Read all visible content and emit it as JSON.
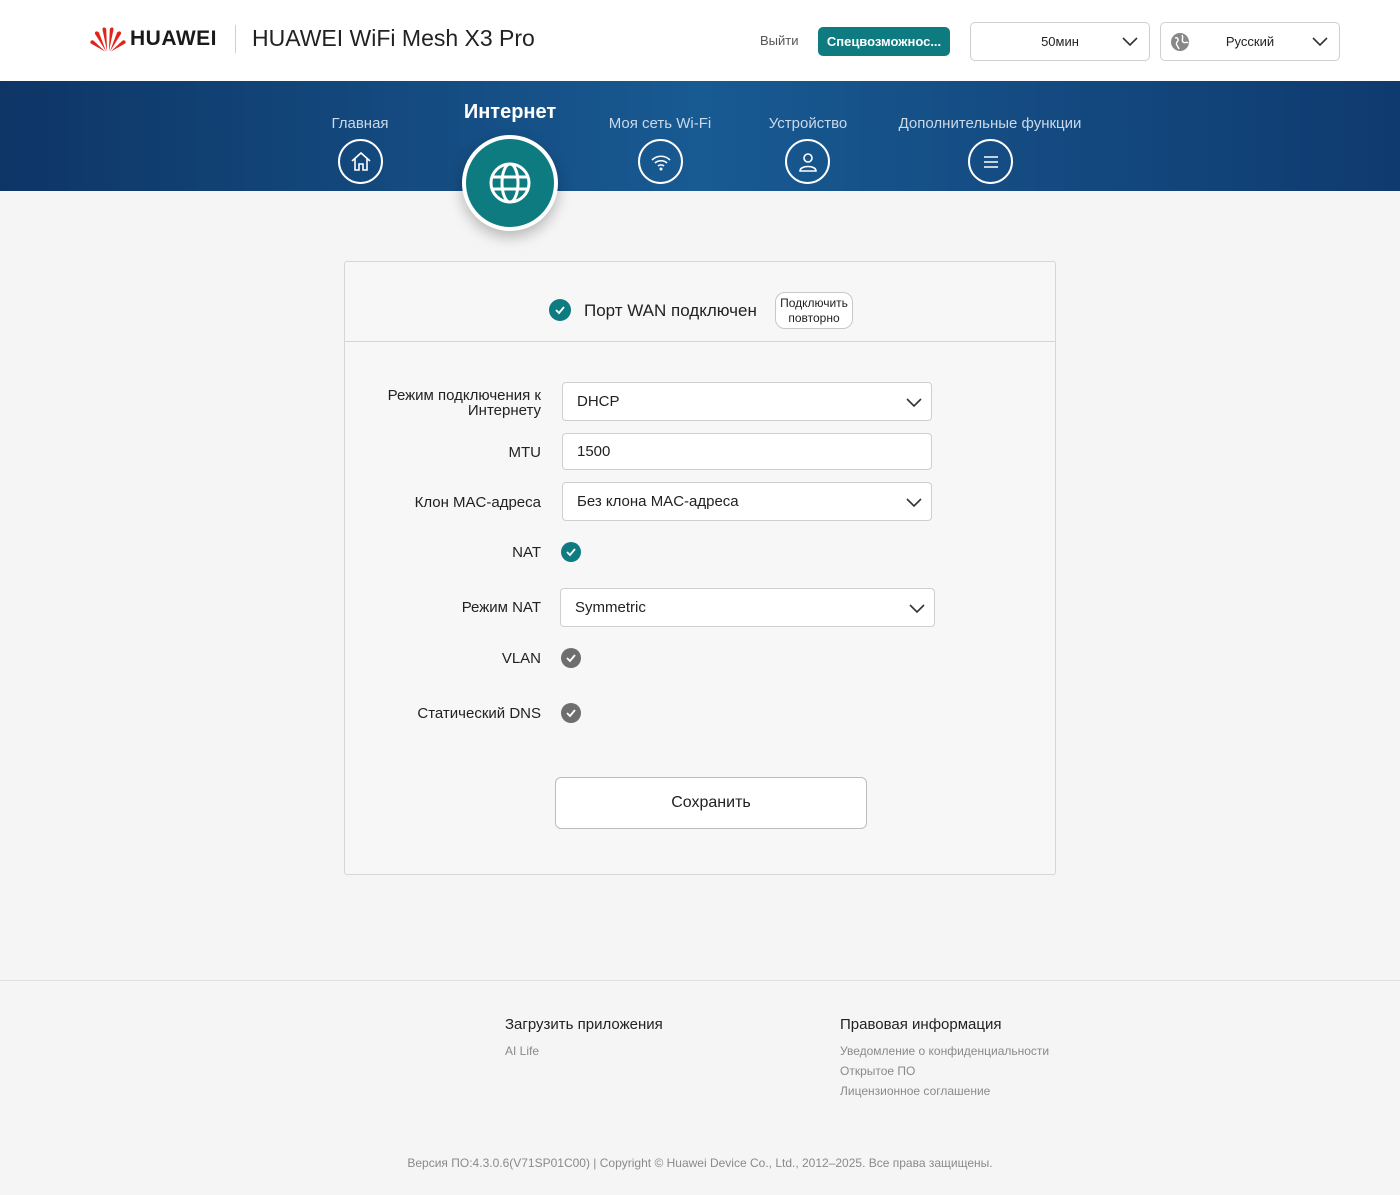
{
  "header": {
    "brand": "HUAWEI",
    "product": "HUAWEI WiFi Mesh X3 Pro",
    "logout": "Выйти",
    "accessibility": "Спецвозможнос...",
    "timeout": "50мин",
    "language": "Русский"
  },
  "nav": {
    "home": "Главная",
    "internet": "Интернет",
    "wifi": "Моя сеть Wi-Fi",
    "device": "Устройство",
    "more": "Дополнительные функции"
  },
  "wan": {
    "status": "Порт WAN подключен",
    "reconnect": "Подключить повторно"
  },
  "form": {
    "mode_label": "Режим подключения к Интернету",
    "mode_value": "DHCP",
    "mtu_label": "MTU",
    "mtu_value": "1500",
    "mac_label": "Клон MAC-адреса",
    "mac_value": "Без клона MAC-адреса",
    "nat_label": "NAT",
    "nat_enabled": true,
    "nat_mode_label": "Режим NAT",
    "nat_mode_value": "Symmetric",
    "vlan_label": "VLAN",
    "vlan_enabled": false,
    "dns_label": "Статический DNS",
    "dns_enabled": false,
    "save": "Сохранить"
  },
  "footer": {
    "apps_title": "Загрузить приложения",
    "apps_link": "AI Life",
    "legal_title": "Правовая информация",
    "legal_links": [
      "Уведомление о конфиденциальности",
      "Открытое ПО",
      "Лицензионное соглашение"
    ],
    "copyright": "Версия ПО:4.3.0.6(V71SP01C00) | Copyright © Huawei Device Co., Ltd., 2012–2025. Все права защищены."
  },
  "colors": {
    "accent": "#0e7b80",
    "nav_band": "#185a92",
    "disabled_check": "#6e6e6e"
  }
}
